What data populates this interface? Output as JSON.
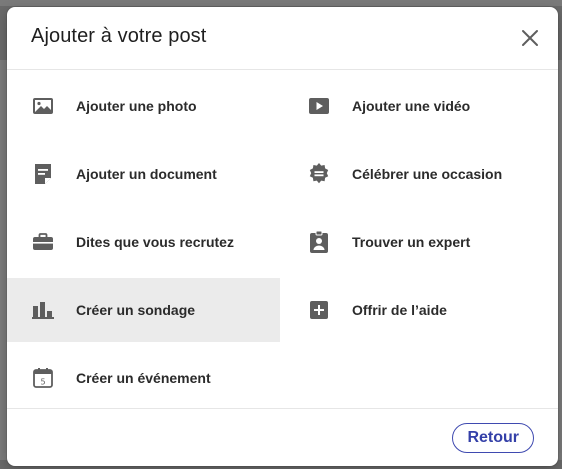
{
  "modal": {
    "title": "Ajouter à votre post",
    "close_icon": "close-icon"
  },
  "options": [
    {
      "id": "photo",
      "label": "Ajouter une photo",
      "icon": "image-icon"
    },
    {
      "id": "video",
      "label": "Ajouter une vidéo",
      "icon": "video-play-icon"
    },
    {
      "id": "document",
      "label": "Ajouter un document",
      "icon": "document-icon"
    },
    {
      "id": "occasion",
      "label": "Célébrer une occasion",
      "icon": "badge-icon"
    },
    {
      "id": "hiring",
      "label": "Dites que vous recrutez",
      "icon": "briefcase-icon"
    },
    {
      "id": "expert",
      "label": "Trouver un expert",
      "icon": "id-badge-icon"
    },
    {
      "id": "poll",
      "label": "Créer un sondage",
      "icon": "bar-chart-icon",
      "state": "hovered"
    },
    {
      "id": "help",
      "label": "Offrir de l’aide",
      "icon": "plus-box-icon"
    },
    {
      "id": "event",
      "label": "Créer un événement",
      "icon": "calendar-icon",
      "calendar_day": "5"
    }
  ],
  "footer": {
    "back_label": "Retour"
  },
  "colors": {
    "icon": "#5e5e5e",
    "accent": "#3440a8",
    "hover_bg": "#ebebeb",
    "label": "#2b2b2b"
  }
}
